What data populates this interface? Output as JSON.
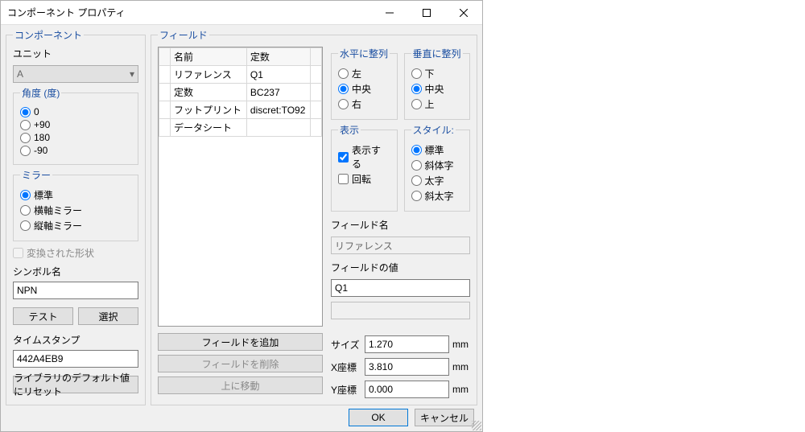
{
  "window": {
    "title": "コンポーネント プロパティ"
  },
  "left": {
    "component_legend": "コンポーネント",
    "unit_label": "ユニット",
    "unit_value": "A",
    "angle_legend": "角度 (度)",
    "angles": [
      "0",
      "+90",
      "180",
      "-90"
    ],
    "angle_selected": 0,
    "mirror_legend": "ミラー",
    "mirrors": [
      "標準",
      "横軸ミラー",
      "縦軸ミラー"
    ],
    "mirror_selected": 0,
    "converted_label": "変換された形状",
    "symbol_label": "シンボル名",
    "symbol_value": "NPN",
    "test_btn": "テスト",
    "select_btn": "選択",
    "timestamp_label": "タイムスタンプ",
    "timestamp_value": "442A4EB9",
    "reset_btn": "ライブラリのデフォルト値にリセット"
  },
  "right": {
    "field_legend": "フィールド",
    "table": {
      "headers": [
        "名前",
        "定数"
      ],
      "rows": [
        {
          "name": "リファレンス",
          "value": "Q1"
        },
        {
          "name": "定数",
          "value": "BC237"
        },
        {
          "name": "フットプリント",
          "value": "discret:TO92"
        },
        {
          "name": "データシート",
          "value": ""
        }
      ]
    },
    "add_btn": "フィールドを追加",
    "del_btn": "フィールドを削除",
    "up_btn": "上に移動",
    "halign_legend": "水平に整列",
    "haligns": [
      "左",
      "中央",
      "右"
    ],
    "halign_selected": 1,
    "valign_legend": "垂直に整列",
    "valigns": [
      "下",
      "中央",
      "上"
    ],
    "valign_selected": 1,
    "show_legend": "表示",
    "show_chk": "表示する",
    "rotate_chk": "回転",
    "style_legend": "スタイル:",
    "styles": [
      "標準",
      "斜体字",
      "太字",
      "斜太字"
    ],
    "style_selected": 0,
    "fieldname_label": "フィールド名",
    "fieldname_value": "リファレンス",
    "fieldvalue_label": "フィールドの値",
    "fieldvalue_value": "Q1",
    "size_label": "サイズ",
    "size_value": "1.270",
    "x_label": "X座標",
    "x_value": "3.810",
    "y_label": "Y座標",
    "y_value": "0.000",
    "unit_mm": "mm"
  },
  "footer": {
    "ok": "OK",
    "cancel": "キャンセル"
  }
}
